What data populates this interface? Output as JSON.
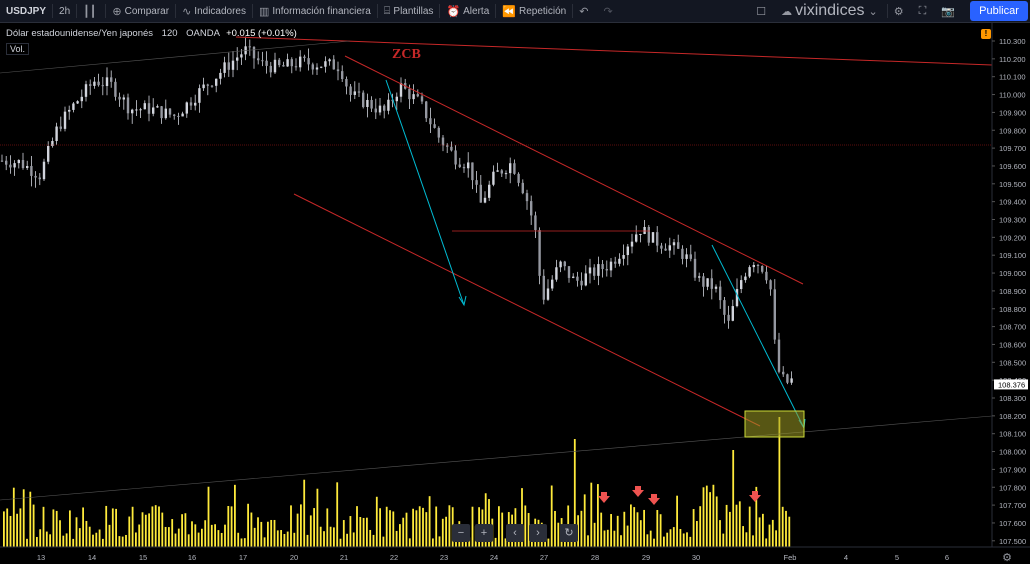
{
  "toolbar": {
    "symbol": "USDJPY",
    "interval": "2h",
    "compare_label": "Comparar",
    "indicators_label": "Indicadores",
    "financials_label": "Información financiera",
    "templates_label": "Plantillas",
    "alert_label": "Alerta",
    "replay_label": "Repetición",
    "layout_name": "vixindices",
    "publish_label": "Publicar"
  },
  "legend": {
    "title": "Dólar estadounidense/Yen japonés",
    "interval": "120",
    "source": "OANDA",
    "change": "+0.015 (+0.01%)",
    "volume_label": "Vol."
  },
  "annotation": "ZCB",
  "alert_badge": "!",
  "price_axis": {
    "ticks": [
      "110.300",
      "110.200",
      "110.100",
      "110.000",
      "109.900",
      "109.800",
      "109.700",
      "109.600",
      "109.500",
      "109.400",
      "109.300",
      "109.200",
      "109.100",
      "109.000",
      "108.900",
      "108.800",
      "108.700",
      "108.600",
      "108.500",
      "108.400",
      "108.300",
      "108.200",
      "108.100",
      "108.000",
      "107.900",
      "107.800",
      "107.700",
      "107.600",
      "107.500"
    ],
    "last_price": "108.376"
  },
  "time_axis": {
    "labels": [
      "13",
      "14",
      "15",
      "16",
      "17",
      "20",
      "21",
      "22",
      "23",
      "24",
      "27",
      "28",
      "29",
      "30",
      "Feb",
      "4",
      "5",
      "6"
    ]
  },
  "colors": {
    "up_candle": "#d1d4dc",
    "volume": "#ffeb3b",
    "channel": "#c62828",
    "arrow": "#00bcd4",
    "box": "#9e9d24",
    "accent": "#2962ff",
    "marker": "#ef5350"
  },
  "chart_data": {
    "type": "candlestick",
    "symbol": "USDJPY",
    "interval": "120",
    "ylim": [
      107.45,
      110.35
    ],
    "last_price": 108.376,
    "annotations": [
      "ZCB"
    ],
    "volume_markers": 4
  }
}
